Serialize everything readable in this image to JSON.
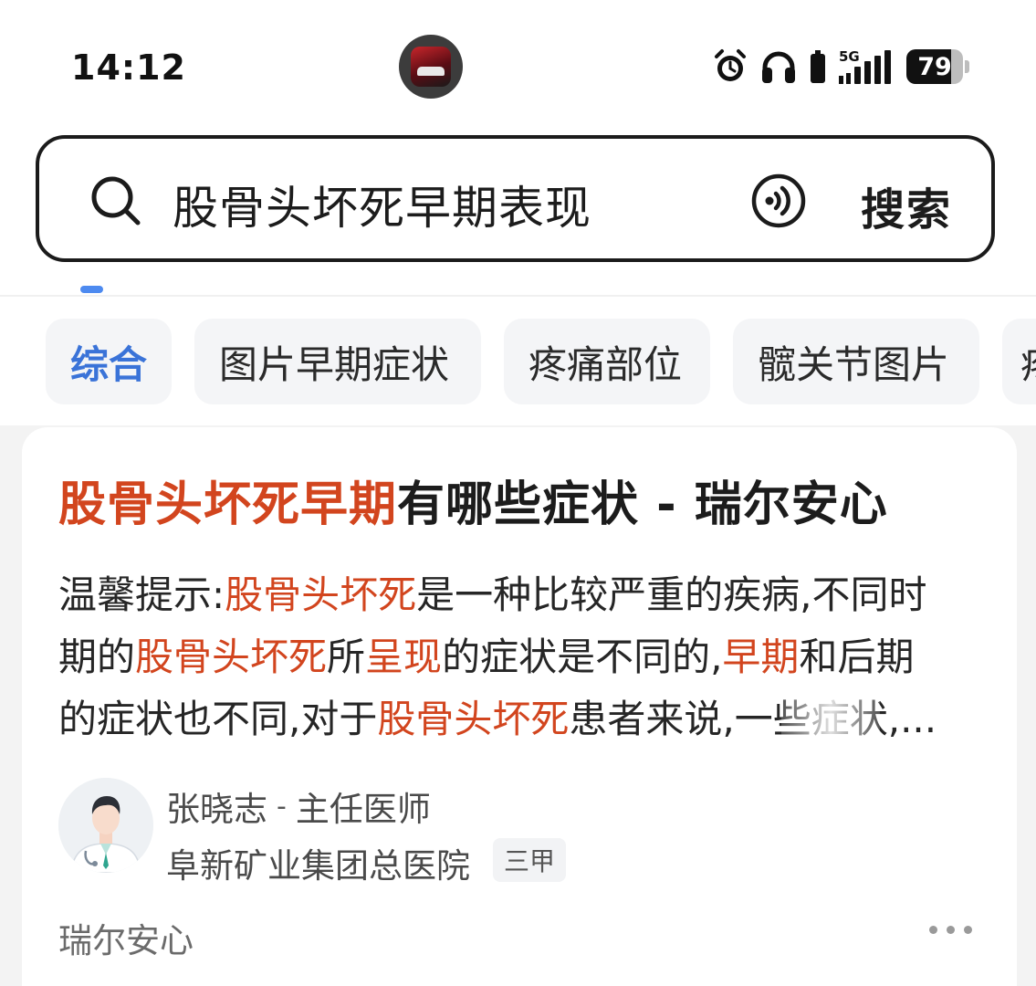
{
  "status_bar": {
    "time": "14:12",
    "app_icon": "racing-game-app-icon",
    "network": "5G",
    "battery": "79",
    "icons": [
      "alarm-icon",
      "headphones-icon",
      "battery-saver-icon",
      "signal-icon",
      "battery-icon"
    ]
  },
  "search": {
    "query": "股骨头坏死早期表现",
    "button_label": "搜索",
    "icons": [
      "search-icon",
      "voice-search-icon"
    ]
  },
  "chips": [
    {
      "label": "综合",
      "active": true
    },
    {
      "label": "图片早期症状",
      "active": false
    },
    {
      "label": "疼痛部位",
      "active": false
    },
    {
      "label": "髋关节图片",
      "active": false
    },
    {
      "label": "疼",
      "active": false
    }
  ],
  "result": {
    "title_highlight": "股骨头坏死早期",
    "title_rest": "有哪些症状 - 瑞尔安心",
    "snippet": {
      "line1": {
        "a": "温馨提示:",
        "b": "股骨头坏死",
        "c": "是一种比较严重的疾病,不同时"
      },
      "line2": {
        "a": "期的",
        "b": "股骨头坏死",
        "c": "所",
        "d": "呈现",
        "e": "的症状是不同的,",
        "f": "早期",
        "g": "和后期"
      },
      "line3": {
        "a": "的症状也不同,对于",
        "b": "股骨头坏死",
        "c": "患者来说,一些症状,..."
      }
    },
    "doctor": {
      "name": "张晓志",
      "separator": "-",
      "title": "主任医师",
      "hospital": "阜新矿业集团总医院",
      "grade": "三甲",
      "avatar_icon": "doctor-avatar-icon"
    },
    "source": "瑞尔安心",
    "more_icon": "more-dots-icon"
  },
  "colors": {
    "highlight": "#d2451e",
    "active_chip": "#3a73d8",
    "tab_indicator": "#4d8af0",
    "chip_bg": "#f4f5f7"
  }
}
